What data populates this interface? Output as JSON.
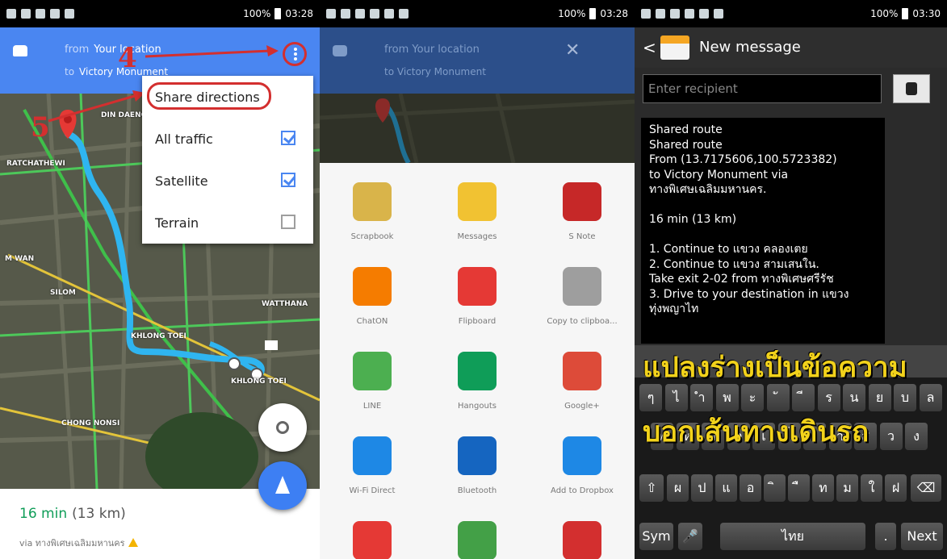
{
  "status": {
    "p1_time": "03:28",
    "p2_time": "03:28",
    "p3_time": "03:30",
    "battery": "100%"
  },
  "maps": {
    "from_label": "from",
    "from_value": "Your location",
    "to_label": "to",
    "to_value": "Victory Monument",
    "menu": [
      {
        "label": "Share directions",
        "checkbox": null
      },
      {
        "label": "All traffic",
        "checkbox": true
      },
      {
        "label": "Satellite",
        "checkbox": true
      },
      {
        "label": "Terrain",
        "checkbox": false
      }
    ],
    "annotation_step4": "4",
    "annotation_step5": "5",
    "map_labels": [
      "RATCHATHEWI",
      "DIN DAENG",
      "M WAN",
      "SILOM",
      "WATTHANA",
      "KHLONG TOEI",
      "KHLONG TOEI",
      "CHONG NONSI"
    ],
    "duration": "16 min",
    "distance": "(13 km)",
    "via": "via ทางพิเศษเฉลิมมหานคร",
    "route_color": "#2fb5f0"
  },
  "share": {
    "from_label": "from",
    "from_value": "Your location",
    "to_label": "to",
    "to_value": "Victory Monument",
    "close_glyph": "✕",
    "apps": [
      {
        "label": "Scrapbook",
        "icon": "scrapbook-icon",
        "color": "#d9b44a"
      },
      {
        "label": "Messages",
        "icon": "messages-icon",
        "color": "#f1c232"
      },
      {
        "label": "S Note",
        "icon": "snote-icon",
        "color": "#c62828"
      },
      {
        "label": "ChatON",
        "icon": "chaton-icon",
        "color": "#f57c00"
      },
      {
        "label": "Flipboard",
        "icon": "flipboard-icon",
        "color": "#e53935"
      },
      {
        "label": "Copy to clipboa...",
        "icon": "clipboard-icon",
        "color": "#9e9e9e"
      },
      {
        "label": "LINE",
        "icon": "line-icon",
        "color": "#4caf50"
      },
      {
        "label": "Hangouts",
        "icon": "hangouts-icon",
        "color": "#0f9d58"
      },
      {
        "label": "Google+",
        "icon": "googleplus-icon",
        "color": "#dd4b39"
      },
      {
        "label": "Wi-Fi Direct",
        "icon": "wifi-direct-icon",
        "color": "#1e88e5"
      },
      {
        "label": "Bluetooth",
        "icon": "bluetooth-icon",
        "color": "#1565c0"
      },
      {
        "label": "Add to Dropbox",
        "icon": "dropbox-icon",
        "color": "#1e88e5"
      },
      {
        "label": "",
        "icon": "email-icon",
        "color": "#e53935"
      },
      {
        "label": "",
        "icon": "evernote-icon",
        "color": "#43a047"
      },
      {
        "label": "",
        "icon": "gmail-icon",
        "color": "#d32f2f"
      }
    ]
  },
  "message": {
    "title": "New message",
    "back_glyph": "<",
    "recipient_placeholder": "Enter recipient",
    "body_lines": [
      "Shared route",
      "Shared route",
      "From (13.7175606,100.5723382)",
      "to Victory Monument via",
      "ทางพิเศษเฉลิมมหานคร.",
      "",
      "16 min (13 km)",
      "",
      "1. Continue to แขวง คลองเตย",
      "2. Continue to แขวง สามเสนใน.",
      "Take exit 2-02 from ทางพิเศษศรีรัช",
      "3. Drive to your destination in แขวง",
      "ทุ่งพญาไท"
    ],
    "overlay_line1": "แปลงร่างเป็นข้อความ",
    "overlay_line2": "บอกเส้นทางเดินรถ",
    "kb_row1": [
      "ๆ",
      "ไ",
      "ำ",
      "พ",
      "ะ",
      "ั",
      "ี",
      "ร",
      "น",
      "ย",
      "บ",
      "ล"
    ],
    "kb_row2": [
      "ฟ",
      "ห",
      "ก",
      "ด",
      "เ",
      "้",
      "่",
      "า",
      "ส",
      "ว",
      "ง"
    ],
    "kb_row3": [
      "ผ",
      "ป",
      "แ",
      "อ",
      "ิ",
      "ื",
      "ท",
      "ม",
      "ใ",
      "ฝ"
    ],
    "sym_label": "Sym",
    "space_label": "ไทย",
    "dot_label": ".",
    "next_label": "Next"
  }
}
